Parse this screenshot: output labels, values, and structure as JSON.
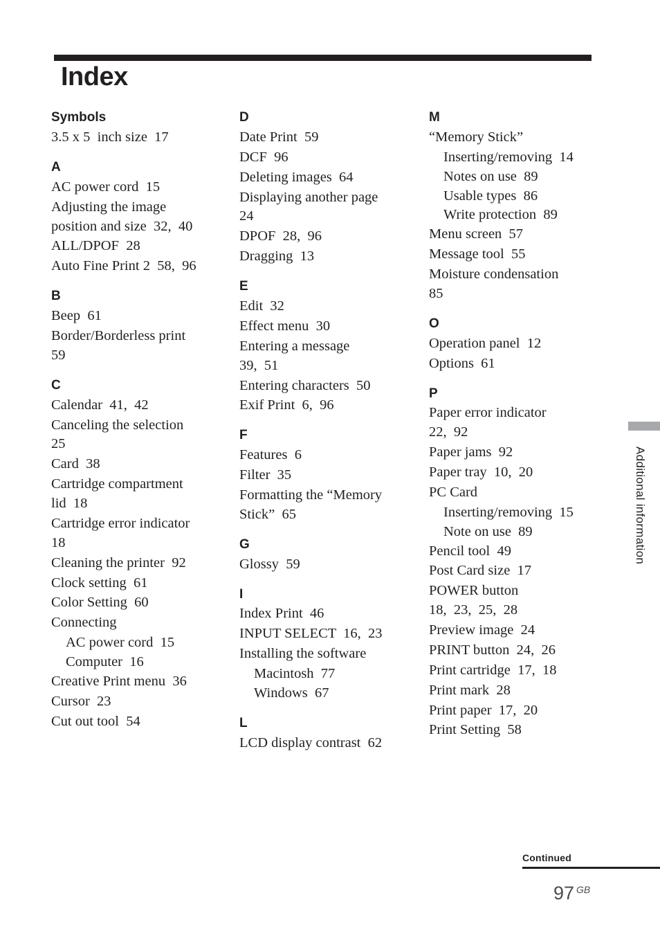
{
  "document": {
    "title": "Index",
    "page_number": "97",
    "page_number_suffix": "GB",
    "continued_label": "Continued",
    "side_tab_label": "Additional information",
    "accent_color": "#231f20",
    "tab_color": "#a6a8ab"
  },
  "columns": [
    {
      "sections": [
        {
          "letter": "Symbols",
          "entries": [
            {
              "text": "3.5 x 5  inch size  17",
              "level": 0
            }
          ]
        },
        {
          "letter": "A",
          "entries": [
            {
              "text": "AC power cord  15",
              "level": 0
            },
            {
              "text": "Adjusting the image\nposition and size  32,  40",
              "level": 0
            },
            {
              "text": "ALL/DPOF  28",
              "level": 0
            },
            {
              "text": "Auto Fine Print 2  58,  96",
              "level": 0
            }
          ]
        },
        {
          "letter": "B",
          "entries": [
            {
              "text": "Beep  61",
              "level": 0
            },
            {
              "text": "Border/Borderless print\n59",
              "level": 0
            }
          ]
        },
        {
          "letter": "C",
          "entries": [
            {
              "text": "Calendar  41,  42",
              "level": 0
            },
            {
              "text": "Canceling the selection\n25",
              "level": 0
            },
            {
              "text": "Card  38",
              "level": 0
            },
            {
              "text": "Cartridge compartment\nlid  18",
              "level": 0
            },
            {
              "text": "Cartridge error indicator\n18",
              "level": 0
            },
            {
              "text": "Cleaning the printer  92",
              "level": 0
            },
            {
              "text": "Clock setting  61",
              "level": 0
            },
            {
              "text": "Color Setting  60",
              "level": 0
            },
            {
              "text": "Connecting",
              "level": 0
            },
            {
              "text": "AC power cord  15",
              "level": 1
            },
            {
              "text": "Computer  16",
              "level": 1
            },
            {
              "text": "Creative Print menu  36",
              "level": 0
            },
            {
              "text": "Cursor  23",
              "level": 0
            },
            {
              "text": "Cut out tool  54",
              "level": 0
            }
          ]
        }
      ]
    },
    {
      "sections": [
        {
          "letter": "D",
          "entries": [
            {
              "text": "Date Print  59",
              "level": 0
            },
            {
              "text": "DCF  96",
              "level": 0
            },
            {
              "text": "Deleting images  64",
              "level": 0
            },
            {
              "text": "Displaying another page\n24",
              "level": 0
            },
            {
              "text": "DPOF  28,  96",
              "level": 0
            },
            {
              "text": "Dragging  13",
              "level": 0
            }
          ]
        },
        {
          "letter": "E",
          "entries": [
            {
              "text": "Edit  32",
              "level": 0
            },
            {
              "text": "Effect menu  30",
              "level": 0
            },
            {
              "text": "Entering a message\n39,  51",
              "level": 0
            },
            {
              "text": "Entering characters  50",
              "level": 0
            },
            {
              "text": "Exif Print  6,  96",
              "level": 0
            }
          ]
        },
        {
          "letter": "F",
          "entries": [
            {
              "text": "Features  6",
              "level": 0
            },
            {
              "text": "Filter  35",
              "level": 0
            },
            {
              "text": "Formatting the “Memory\nStick”  65",
              "level": 0
            }
          ]
        },
        {
          "letter": "G",
          "entries": [
            {
              "text": "Glossy  59",
              "level": 0
            }
          ]
        },
        {
          "letter": "I",
          "entries": [
            {
              "text": "Index Print  46",
              "level": 0
            },
            {
              "text": "INPUT SELECT  16,  23",
              "level": 0
            },
            {
              "text": "Installing the software",
              "level": 0
            },
            {
              "text": "Macintosh  77",
              "level": 1
            },
            {
              "text": "Windows  67",
              "level": 1
            }
          ]
        },
        {
          "letter": "L",
          "entries": [
            {
              "text": "LCD display contrast  62",
              "level": 0
            }
          ]
        }
      ]
    },
    {
      "sections": [
        {
          "letter": "M",
          "entries": [
            {
              "text": "“Memory Stick”",
              "level": 0
            },
            {
              "text": "Inserting/removing  14",
              "level": 1
            },
            {
              "text": "Notes on use  89",
              "level": 1
            },
            {
              "text": "Usable types  86",
              "level": 1
            },
            {
              "text": "Write protection  89",
              "level": 1
            },
            {
              "text": "Menu screen  57",
              "level": 0
            },
            {
              "text": "Message tool  55",
              "level": 0
            },
            {
              "text": "Moisture condensation\n85",
              "level": 0
            }
          ]
        },
        {
          "letter": "O",
          "entries": [
            {
              "text": "Operation panel  12",
              "level": 0
            },
            {
              "text": "Options  61",
              "level": 0
            }
          ]
        },
        {
          "letter": "P",
          "entries": [
            {
              "text": "Paper error indicator\n22,  92",
              "level": 0
            },
            {
              "text": "Paper jams  92",
              "level": 0
            },
            {
              "text": "Paper tray  10,  20",
              "level": 0
            },
            {
              "text": "PC Card",
              "level": 0
            },
            {
              "text": "Inserting/removing  15",
              "level": 1
            },
            {
              "text": "Note on use  89",
              "level": 1
            },
            {
              "text": "Pencil tool  49",
              "level": 0
            },
            {
              "text": "Post Card size  17",
              "level": 0
            },
            {
              "text": "POWER button\n18,  23,  25,  28",
              "level": 0
            },
            {
              "text": "Preview image  24",
              "level": 0
            },
            {
              "text": "PRINT button  24,  26",
              "level": 0
            },
            {
              "text": "Print cartridge  17,  18",
              "level": 0
            },
            {
              "text": "Print mark  28",
              "level": 0
            },
            {
              "text": "Print paper  17,  20",
              "level": 0
            },
            {
              "text": "Print Setting  58",
              "level": 0
            }
          ]
        }
      ]
    }
  ]
}
